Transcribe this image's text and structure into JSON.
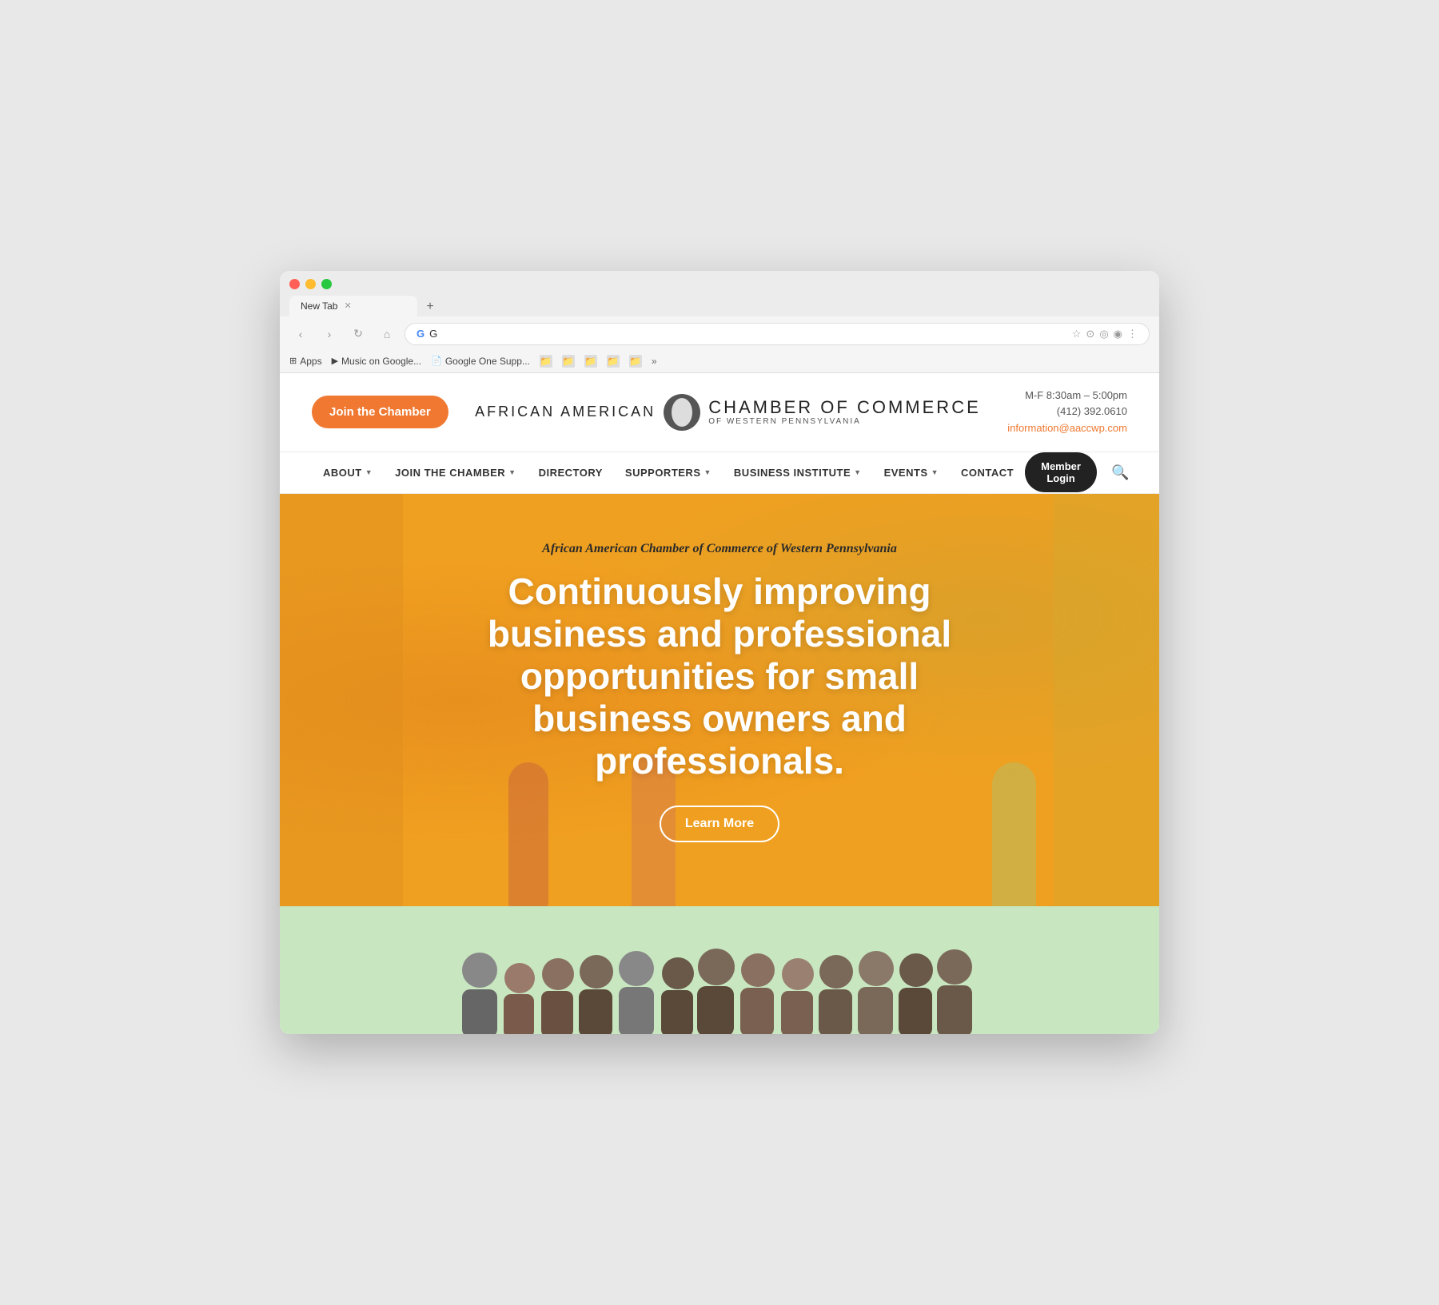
{
  "browser": {
    "tab_title": "New Tab",
    "url": "G",
    "traffic_lights": [
      "red",
      "yellow",
      "green"
    ],
    "bookmarks": [
      {
        "label": "Apps",
        "icon": "⊞"
      },
      {
        "label": "Music on Google...",
        "icon": "▶"
      },
      {
        "label": "Google One Supp...",
        "icon": "📄"
      },
      {
        "label": "",
        "icon": "📁"
      },
      {
        "label": "",
        "icon": "📁"
      },
      {
        "label": "",
        "icon": "📁"
      },
      {
        "label": "",
        "icon": "📁"
      },
      {
        "label": "",
        "icon": "📁"
      },
      {
        "label": "»",
        "icon": ""
      }
    ]
  },
  "header": {
    "join_btn": "Join the Chamber",
    "logo_left": "AFRICAN AMERICAN",
    "logo_right_main": "CHAMBER OF COMMERCE",
    "logo_right_sub": "OF WESTERN PENNSYLVANIA",
    "hours": "M-F 8:30am – 5:00pm",
    "phone": "(412) 392.0610",
    "email": "information@aaccwp.com"
  },
  "nav": {
    "items": [
      {
        "label": "ABOUT",
        "has_dropdown": true
      },
      {
        "label": "JOIN THE CHAMBER",
        "has_dropdown": true
      },
      {
        "label": "DIRECTORY",
        "has_dropdown": false
      },
      {
        "label": "SUPPORTERS",
        "has_dropdown": true
      },
      {
        "label": "BUSINESS INSTITUTE",
        "has_dropdown": true
      },
      {
        "label": "EVENTS",
        "has_dropdown": true
      },
      {
        "label": "CONTACT",
        "has_dropdown": false
      }
    ],
    "member_login": "Member Login",
    "search_placeholder": "Search"
  },
  "hero": {
    "subtitle": "African American Chamber of Commerce of Western Pennsylvania",
    "title": "Continuously improving business and professional opportunities for small business owners and professionals.",
    "cta": "Learn More"
  },
  "team": {
    "label": "Team photo"
  }
}
